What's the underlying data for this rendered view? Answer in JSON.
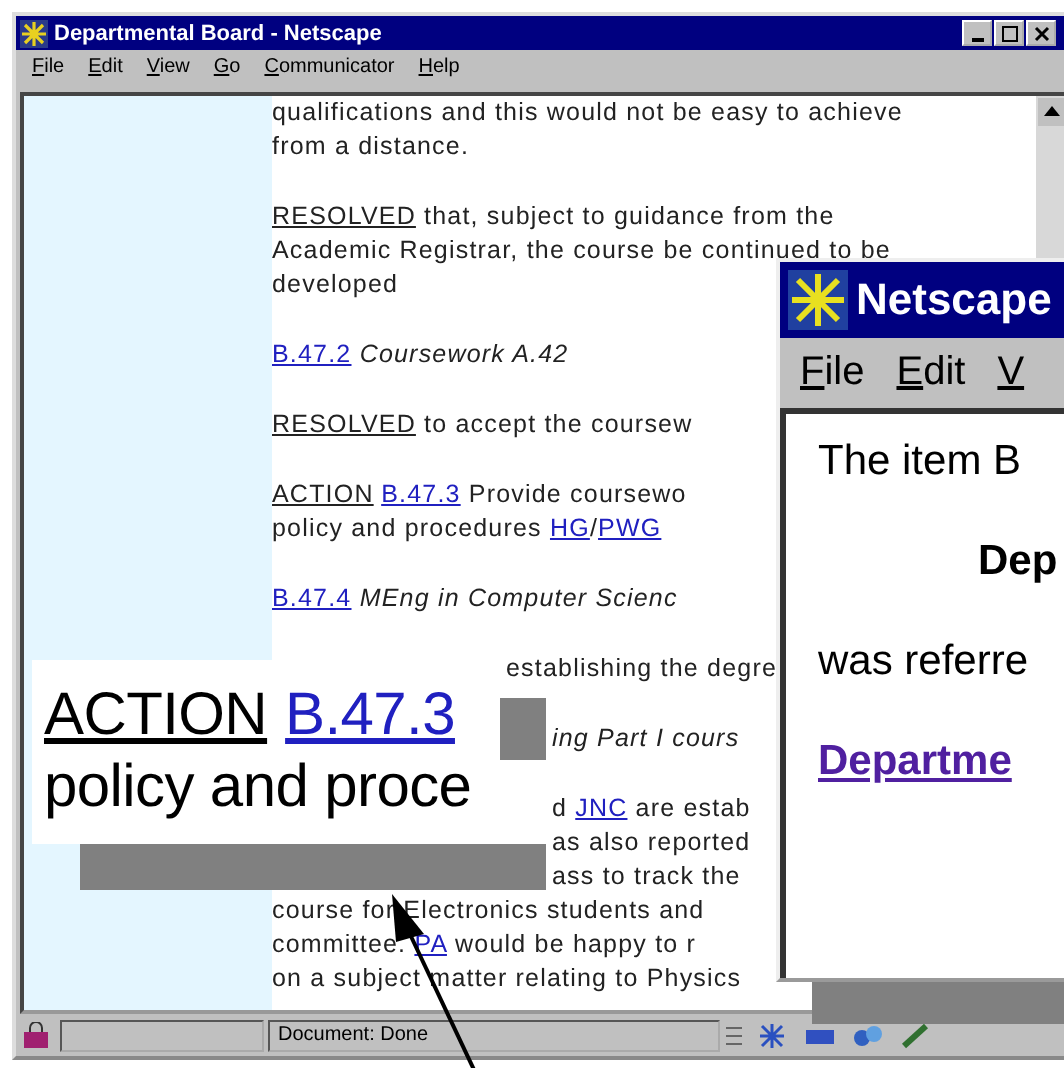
{
  "main_window": {
    "title": "Departmental Board - Netscape",
    "menu": [
      "File",
      "Edit",
      "View",
      "Go",
      "Communicator",
      "Help"
    ],
    "paragraphs": [
      [
        {
          "kind": "full",
          "segments": [
            {
              "kind": "text",
              "text": "qualifications and this would not be easy to achieve"
            }
          ]
        },
        {
          "kind": "full",
          "segments": [
            {
              "kind": "text",
              "text": "from a distance."
            }
          ]
        }
      ],
      [
        {
          "kind": "full",
          "segments": [
            {
              "kind": "underline",
              "text": "RESOLVED"
            },
            {
              "kind": "text",
              "text": " that, subject to guidance from the"
            }
          ]
        },
        {
          "kind": "full",
          "segments": [
            {
              "kind": "text",
              "text": "Academic Registrar, the course be continued to be"
            }
          ]
        },
        {
          "kind": "full",
          "segments": [
            {
              "kind": "text",
              "text": "developed"
            }
          ]
        }
      ],
      [
        {
          "kind": "full",
          "segments": [
            {
              "kind": "link",
              "text": "B.47.2"
            },
            {
              "kind": "italic",
              "text": " Coursework A.42"
            }
          ]
        }
      ],
      [
        {
          "kind": "full",
          "segments": [
            {
              "kind": "underline",
              "text": "RESOLVED"
            },
            {
              "kind": "text",
              "text": " to accept the coursew"
            }
          ]
        }
      ],
      [
        {
          "kind": "full",
          "segments": [
            {
              "kind": "underline",
              "text": "ACTION"
            },
            {
              "kind": "link",
              "text": "B.47.3"
            },
            {
              "kind": "text",
              "text": " Provide coursewo"
            }
          ]
        },
        {
          "kind": "full",
          "segments": [
            {
              "kind": "text",
              "text": "policy and procedures "
            },
            {
              "kind": "link",
              "text": "HG"
            },
            {
              "kind": "text",
              "text": "/"
            },
            {
              "kind": "link",
              "text": "PWG"
            }
          ]
        }
      ],
      [
        {
          "kind": "full",
          "segments": [
            {
              "kind": "link",
              "text": "B.47.4"
            },
            {
              "kind": "italic",
              "text": " MEng in Computer Scienc"
            }
          ]
        }
      ],
      [
        {
          "kind": "after_callout",
          "segments": [
            {
              "kind": "text",
              "text": "establishing the degre"
            }
          ]
        }
      ],
      [
        {
          "kind": "after_shadow",
          "segments": [
            {
              "kind": "italic",
              "text": "ing Part I cours"
            }
          ]
        }
      ],
      [
        {
          "kind": "after_shadow",
          "segments": [
            {
              "kind": "text",
              "text": "d "
            },
            {
              "kind": "link",
              "text": "JNC"
            },
            {
              "kind": "text",
              "text": " are estab"
            }
          ]
        },
        {
          "kind": "after_shadow",
          "segments": [
            {
              "kind": "text",
              "text": "as also reported"
            }
          ]
        },
        {
          "kind": "after_shadow",
          "segments": [
            {
              "kind": "text",
              "text": "ass to track the"
            }
          ]
        },
        {
          "kind": "full",
          "segments": [
            {
              "kind": "text",
              "text": "course for Electronics students and"
            }
          ]
        },
        {
          "kind": "full",
          "segments": [
            {
              "kind": "text",
              "text": "committee. "
            },
            {
              "kind": "link",
              "text": "PA"
            },
            {
              "kind": "text",
              "text": " would be happy to r"
            }
          ]
        },
        {
          "kind": "full",
          "segments": [
            {
              "kind": "text",
              "text": "on a subject matter relating to Physics"
            }
          ]
        }
      ]
    ],
    "status": "Document: Done"
  },
  "popup_window": {
    "title": "Netscape",
    "menu": [
      "File",
      "Edit",
      "V"
    ],
    "lines": [
      {
        "kind": "text",
        "text": "The item B"
      },
      {
        "kind": "heading",
        "text": "Dep"
      },
      {
        "kind": "text",
        "text": "was referre"
      },
      {
        "kind": "link",
        "text": "Departme"
      }
    ]
  },
  "callout": {
    "lines": [
      [
        {
          "kind": "underline",
          "text": "ACTION"
        },
        {
          "kind": "link",
          "text": "B.47.3"
        }
      ],
      [
        {
          "kind": "text",
          "text": "policy and proce"
        }
      ]
    ]
  }
}
